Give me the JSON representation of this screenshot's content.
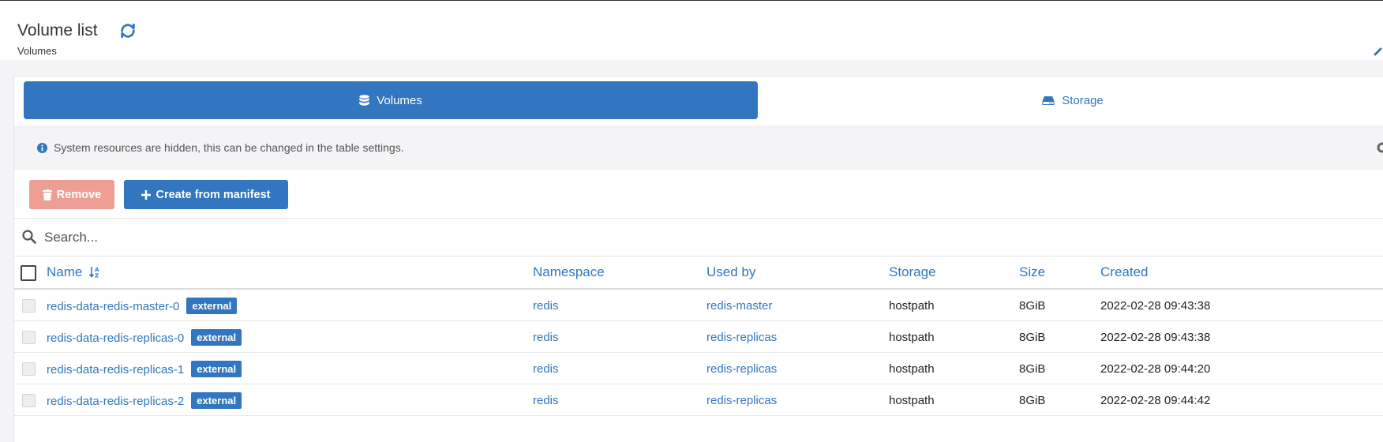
{
  "header": {
    "title": "Volume list",
    "breadcrumb": "Volumes",
    "refresh_icon": "refresh-icon"
  },
  "tabs": [
    {
      "label": "Volumes",
      "icon": "database-icon",
      "active": true
    },
    {
      "label": "Storage",
      "icon": "hard-drive-icon",
      "active": false
    }
  ],
  "info": {
    "message": "System resources are hidden, this can be changed in the table settings.",
    "icon": "info-circle-icon"
  },
  "actions": {
    "remove_label": "Remove",
    "create_label": "Create from manifest"
  },
  "search": {
    "placeholder": "Search..."
  },
  "table": {
    "columns": [
      "Name",
      "Namespace",
      "Used by",
      "Storage",
      "Size",
      "Created"
    ],
    "rows": [
      {
        "name": "redis-data-redis-master-0",
        "badge": "external",
        "namespace": "redis",
        "used_by": "redis-master",
        "storage": "hostpath",
        "size": "8GiB",
        "created": "2022-02-28 09:43:38"
      },
      {
        "name": "redis-data-redis-replicas-0",
        "badge": "external",
        "namespace": "redis",
        "used_by": "redis-replicas",
        "storage": "hostpath",
        "size": "8GiB",
        "created": "2022-02-28 09:43:38"
      },
      {
        "name": "redis-data-redis-replicas-1",
        "badge": "external",
        "namespace": "redis",
        "used_by": "redis-replicas",
        "storage": "hostpath",
        "size": "8GiB",
        "created": "2022-02-28 09:44:20"
      },
      {
        "name": "redis-data-redis-replicas-2",
        "badge": "external",
        "namespace": "redis",
        "used_by": "redis-replicas",
        "storage": "hostpath",
        "size": "8GiB",
        "created": "2022-02-28 09:44:42"
      }
    ]
  },
  "colors": {
    "accent": "#3176bf",
    "danger_disabled": "#ee9e93",
    "background": "#f4f3f6"
  }
}
